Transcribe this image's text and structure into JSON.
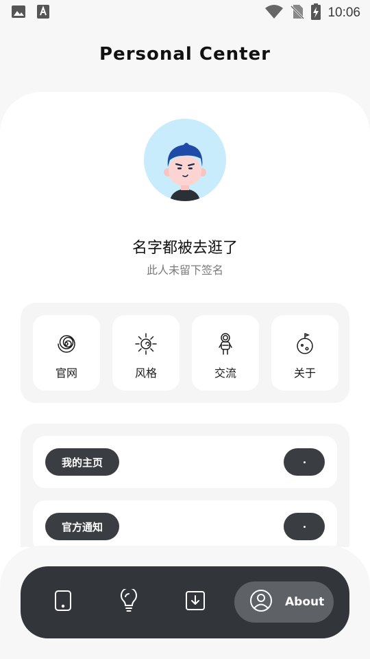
{
  "status_bar": {
    "time": "10:06",
    "left_icons": [
      "image-icon",
      "text-a-icon"
    ],
    "right_icons": [
      "wifi-icon",
      "no-sim-icon",
      "battery-charging-icon"
    ]
  },
  "header": {
    "title": "Personal Center"
  },
  "profile": {
    "name": "名字都被去逛了",
    "signature": "此人未留下签名",
    "avatar_bg": "#c9ecfd"
  },
  "grid": {
    "items": [
      {
        "label": "官网",
        "icon": "spiral-icon"
      },
      {
        "label": "风格",
        "icon": "sun-spiral-icon"
      },
      {
        "label": "交流",
        "icon": "astronaut-icon"
      },
      {
        "label": "关于",
        "icon": "planet-icon"
      }
    ]
  },
  "list": {
    "rows": [
      {
        "label": "我的主页"
      },
      {
        "label": "官方通知"
      }
    ]
  },
  "bottom_nav": {
    "items": [
      {
        "icon": "phone-icon"
      },
      {
        "icon": "lightbulb-icon"
      },
      {
        "icon": "download-icon"
      },
      {
        "icon": "user-icon",
        "label": "About",
        "active": true
      }
    ],
    "bar_color": "#32363a",
    "active_color": "#5e6266"
  }
}
